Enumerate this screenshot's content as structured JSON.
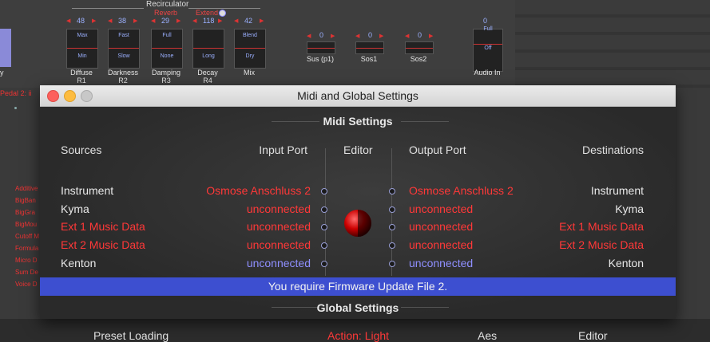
{
  "background": {
    "recirculator_title": "Recirculator",
    "reverb_label": "Reverb",
    "extend_label": "Extend",
    "params": [
      {
        "value": "48",
        "top": "Max",
        "bottom": "Min",
        "name1": "Diffuse",
        "name2": "R1"
      },
      {
        "value": "38",
        "top": "Fast",
        "bottom": "Slow",
        "name1": "Darkness",
        "name2": "R2"
      },
      {
        "value": "29",
        "top": "Full",
        "bottom": "None",
        "name1": "Damping",
        "name2": "R3"
      },
      {
        "value": "118",
        "top": "",
        "bottom": "Long",
        "name1": "Decay",
        "name2": "R4"
      },
      {
        "value": "42",
        "top": "Blend",
        "bottom": "Dry",
        "name1": "Mix",
        "name2": ""
      }
    ],
    "small_controls": [
      {
        "value": "0",
        "name": "Sus (p1)"
      },
      {
        "value": "0",
        "name": "Sos1"
      },
      {
        "value": "0",
        "name": "Sos2"
      }
    ],
    "audio_in": {
      "value": "0",
      "top": "Full",
      "bottom": "Off",
      "name": "Audio In"
    },
    "left_fragment": "y",
    "pedal_label": "Pedal 2:  ii",
    "left_list": [
      "Additive",
      "BigBan",
      "BigGra",
      "BigMou",
      "Cutoff M",
      "Formula",
      "Micro D",
      "Sum De",
      "Voice D"
    ]
  },
  "window": {
    "title": "Midi and Global Settings",
    "midi_section_title": "Midi Settings",
    "headers": {
      "sources": "Sources",
      "input_port": "Input Port",
      "editor": "Editor",
      "output_port": "Output Port",
      "destinations": "Destinations"
    },
    "rows": [
      {
        "source": "Instrument",
        "input": "Osmose Anschluss 2",
        "output": "Osmose Anschluss 2",
        "dest": "Instrument",
        "source_color": "w",
        "input_color": "r",
        "output_color": "r",
        "dest_color": "w"
      },
      {
        "source": "Kyma",
        "input": "unconnected",
        "output": "unconnected",
        "dest": "Kyma",
        "source_color": "w",
        "input_color": "r",
        "output_color": "r",
        "dest_color": "w"
      },
      {
        "source": "Ext 1 Music Data",
        "input": "unconnected",
        "output": "unconnected",
        "dest": "Ext 1 Music Data",
        "source_color": "r",
        "input_color": "r",
        "output_color": "r",
        "dest_color": "r"
      },
      {
        "source": "Ext 2 Music Data",
        "input": "unconnected",
        "output": "unconnected",
        "dest": "Ext 2 Music Data",
        "source_color": "r",
        "input_color": "r",
        "output_color": "r",
        "dest_color": "r"
      },
      {
        "source": "Kenton",
        "input": "unconnected",
        "output": "unconnected",
        "dest": "Kenton",
        "source_color": "w",
        "input_color": "b",
        "output_color": "b",
        "dest_color": "w"
      }
    ],
    "banner": "You require Firmware Update File 2.",
    "global_section_title": "Global Settings",
    "global_headers": {
      "preset_loading": "Preset Loading",
      "action": "Action: Light",
      "aes": "Aes",
      "editor": "Editor"
    }
  }
}
